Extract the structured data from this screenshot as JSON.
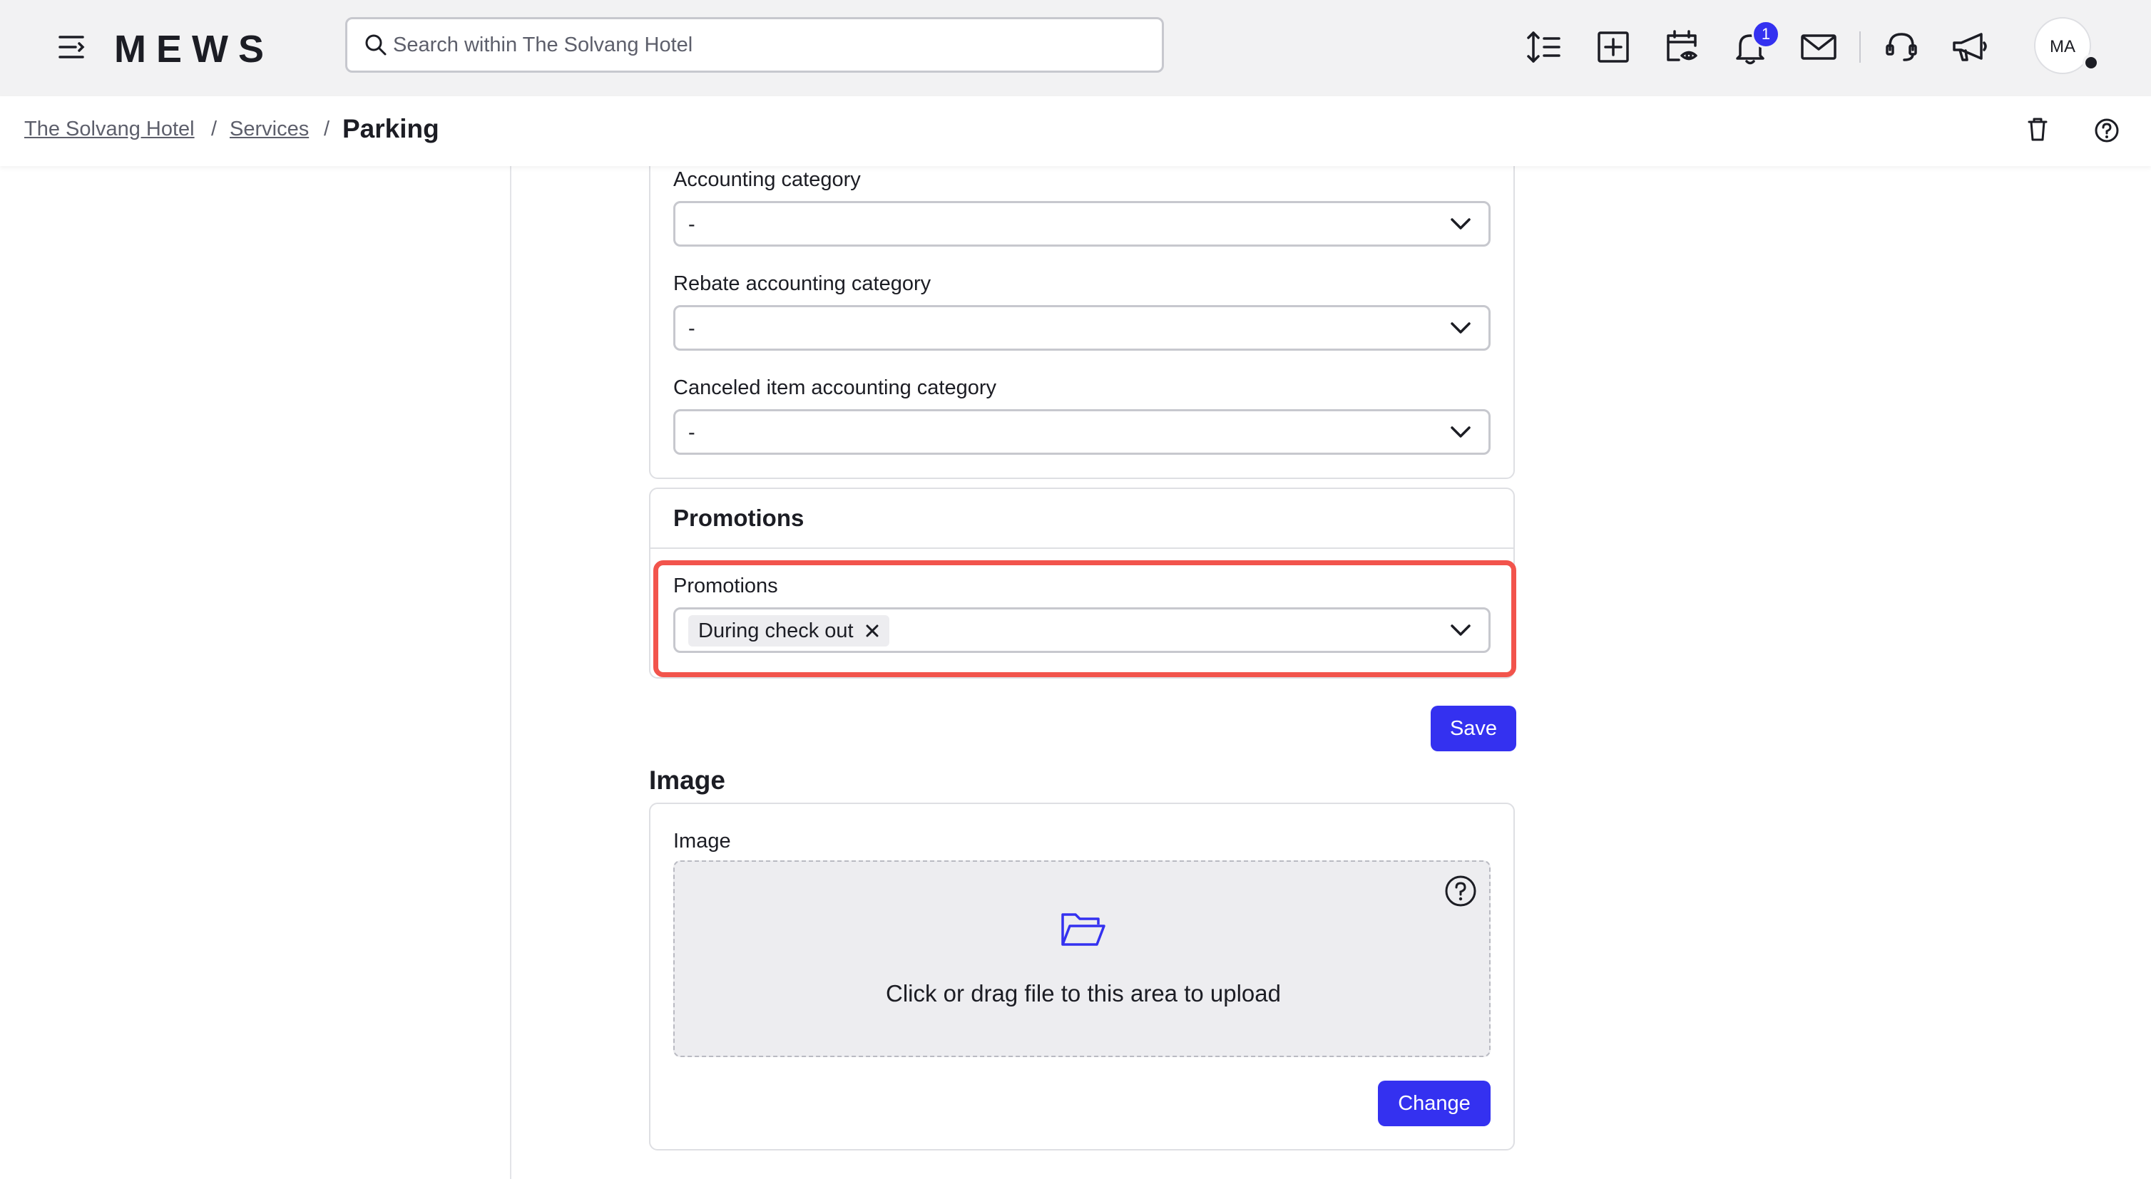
{
  "brand": "MEWS",
  "search": {
    "placeholder": "Search within The Solvang Hotel",
    "value": ""
  },
  "toolbar": {
    "icons": [
      "sort-icon",
      "add-icon",
      "calendar-view-icon",
      "bell-icon",
      "mail-icon",
      "support-icon",
      "megaphone-icon"
    ],
    "notification_count": "1",
    "avatar_initials": "MA"
  },
  "breadcrumb": {
    "items": [
      "The Solvang Hotel",
      "Services"
    ],
    "separator": "/",
    "current": "Parking"
  },
  "accounting": {
    "fields": [
      {
        "label": "Accounting category",
        "value": "-"
      },
      {
        "label": "Rebate accounting category",
        "value": "-"
      },
      {
        "label": "Canceled item accounting category",
        "value": "-"
      }
    ]
  },
  "promotions": {
    "section_title": "Promotions",
    "field_label": "Promotions",
    "selected": [
      "During check out"
    ],
    "save_label": "Save"
  },
  "image": {
    "section_title": "Image",
    "field_label": "Image",
    "dropzone_text": "Click or drag file to this area to upload",
    "change_label": "Change"
  },
  "colors": {
    "accent": "#3431f0",
    "highlight": "#f2544c",
    "topbar_bg": "#f2f2f3"
  }
}
